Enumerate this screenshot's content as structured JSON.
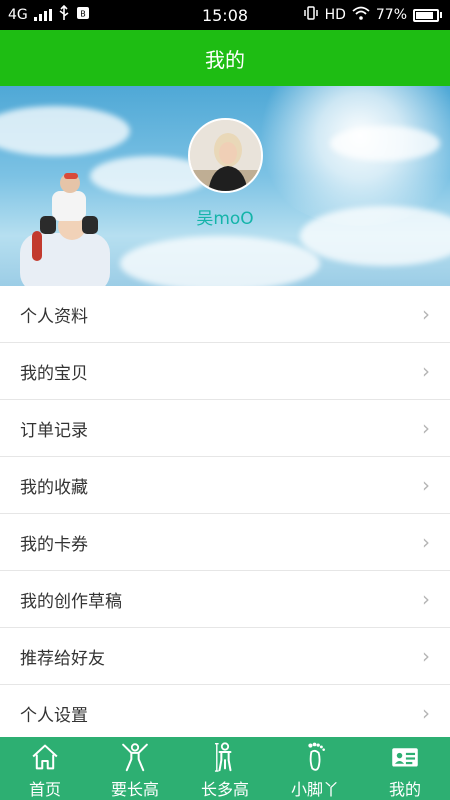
{
  "status_bar": {
    "network": "4G",
    "time": "15:08",
    "hd": "HD",
    "battery_percent": "77%",
    "battery_level": 0.77
  },
  "title_bar": {
    "title": "我的"
  },
  "profile": {
    "username": "吴moO"
  },
  "menu": {
    "items": [
      {
        "label": "个人资料"
      },
      {
        "label": "我的宝贝"
      },
      {
        "label": "订单记录"
      },
      {
        "label": "我的收藏"
      },
      {
        "label": "我的卡券"
      },
      {
        "label": "我的创作草稿"
      },
      {
        "label": "推荐给好友"
      },
      {
        "label": "个人设置"
      }
    ],
    "chevron": "›"
  },
  "tab_bar": {
    "tabs": [
      {
        "label": "首页",
        "icon": "home-icon"
      },
      {
        "label": "要长高",
        "icon": "stretch-person-icon"
      },
      {
        "label": "长多高",
        "icon": "height-person-icon"
      },
      {
        "label": "小脚丫",
        "icon": "footprint-icon"
      },
      {
        "label": "我的",
        "icon": "profile-card-icon"
      }
    ]
  },
  "colors": {
    "title_bar": "#1ebd13",
    "tab_bar": "#2daf72",
    "username": "#14b4a9"
  }
}
